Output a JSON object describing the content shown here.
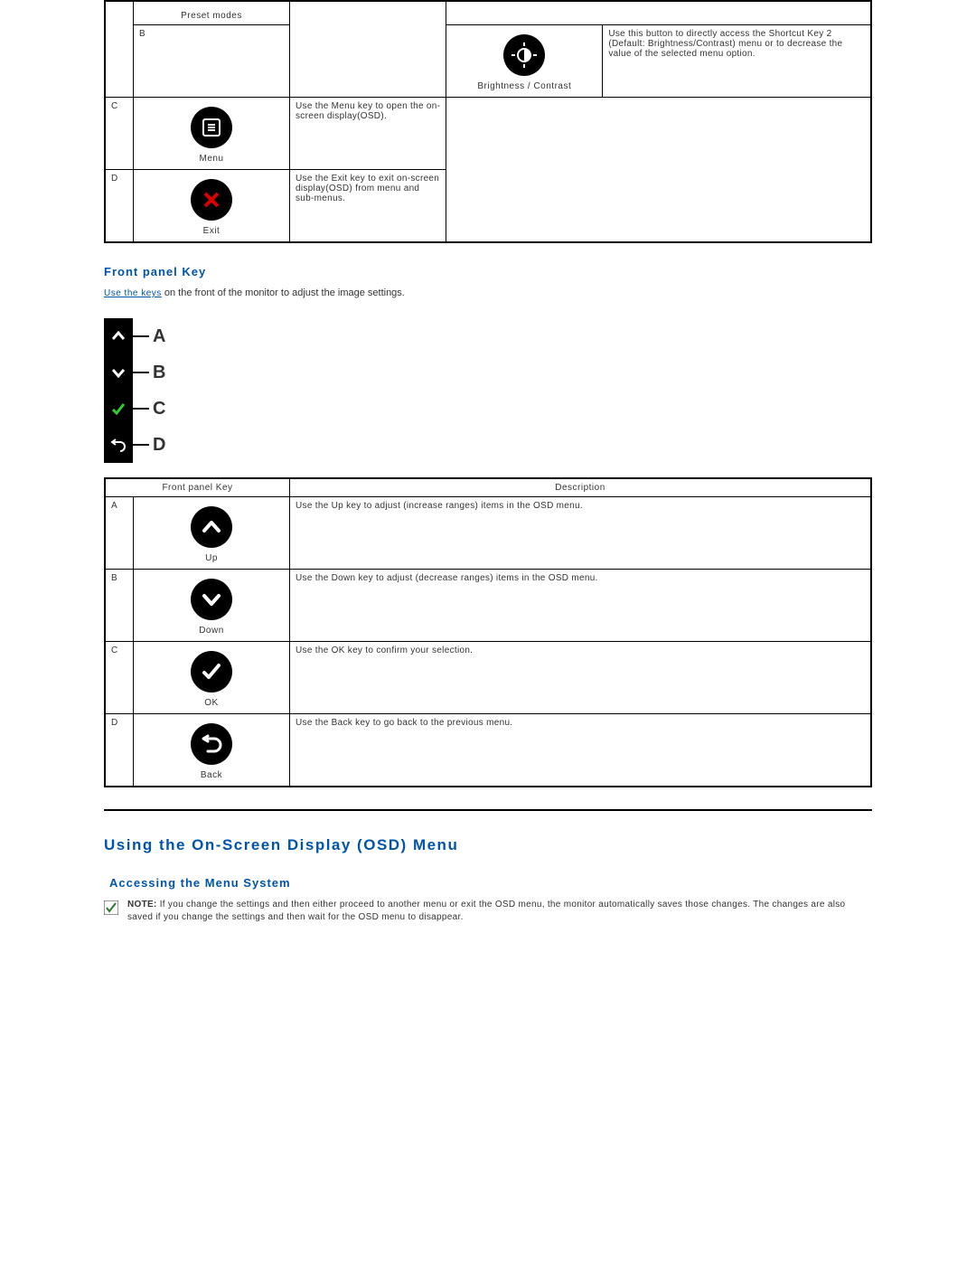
{
  "table1": {
    "rows": [
      {
        "letter": "",
        "label": "Preset modes",
        "desc": "",
        "icon": ""
      },
      {
        "letter": "B",
        "label": "Brightness / Contrast",
        "desc": "Use this button to directly access the Shortcut Key 2 (Default: Brightness/Contrast) menu or to decrease the value of the selected menu option.",
        "icon": "brightness"
      },
      {
        "letter": "C",
        "label": "Menu",
        "desc": "Use the Menu key to open the on-screen display(OSD).",
        "icon": "menu"
      },
      {
        "letter": "D",
        "label": "Exit",
        "desc": "Use the Exit key to exit on-screen display(OSD) from menu and sub-menus.",
        "icon": "exit"
      }
    ]
  },
  "front_panel": {
    "heading": "Front panel Key",
    "link_text": "Use the keys",
    "text_after": " on the front of the monitor to adjust the image settings.",
    "legend": [
      {
        "letter": "A",
        "icon": "up"
      },
      {
        "letter": "B",
        "icon": "down"
      },
      {
        "letter": "C",
        "icon": "ok"
      },
      {
        "letter": "D",
        "icon": "back"
      }
    ],
    "table_headers": {
      "col1": "Front panel Key",
      "col2": "Description"
    },
    "rows": [
      {
        "letter": "A",
        "label": "Up",
        "desc": "Use the Up key to adjust (increase ranges) items in the OSD menu.",
        "icon": "up"
      },
      {
        "letter": "B",
        "label": "Down",
        "desc": "Use the Down key to adjust (decrease ranges) items in the OSD menu.",
        "icon": "down"
      },
      {
        "letter": "C",
        "label": "OK",
        "desc": "Use the OK key to confirm your selection.",
        "icon": "ok"
      },
      {
        "letter": "D",
        "label": "Back",
        "desc": "Use the Back key to go back to the previous menu.",
        "icon": "back"
      }
    ]
  },
  "osd": {
    "heading": "Using the On-Screen Display (OSD) Menu",
    "subheading": "Accessing the Menu System",
    "note_label": "NOTE:",
    "note_text": " If you change the settings and then either proceed to another menu or exit the OSD menu, the monitor automatically saves those changes. The changes are also saved if you change the settings and then wait for the OSD menu to disappear."
  }
}
